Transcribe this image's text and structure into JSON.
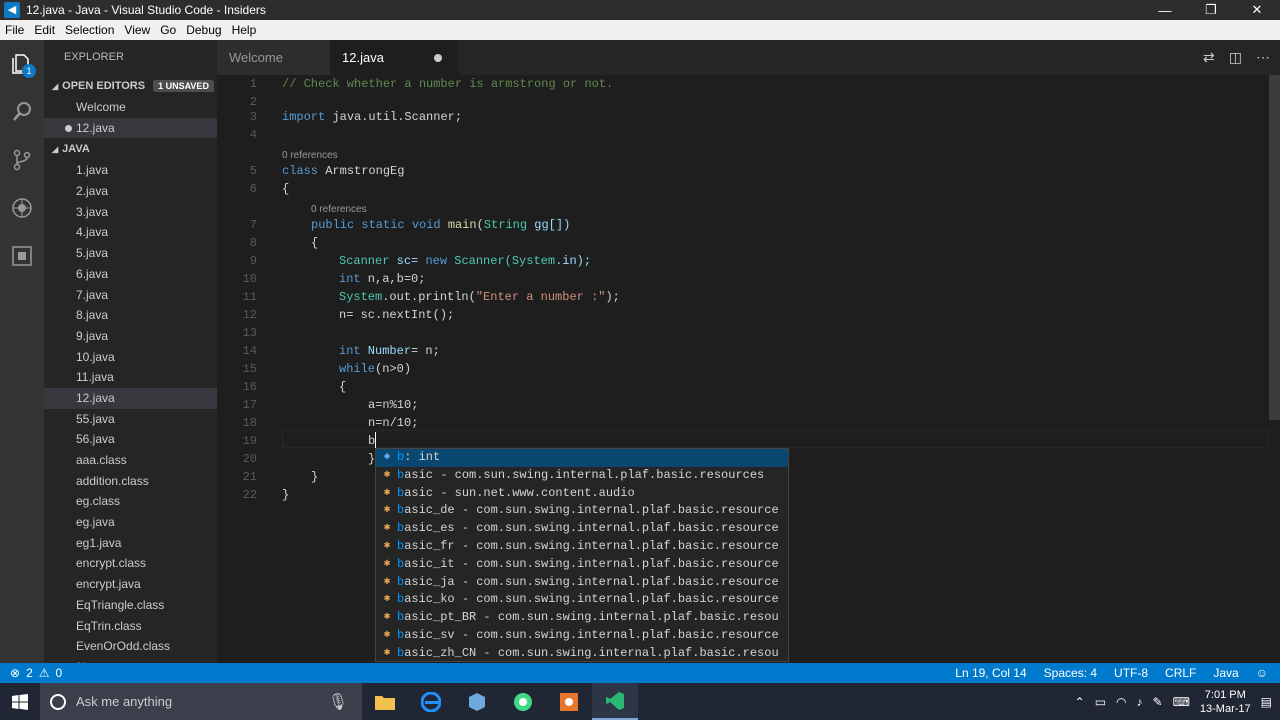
{
  "window": {
    "title": "12.java - Java - Visual Studio Code - Insiders",
    "min": "—",
    "max": "❐",
    "close": "✕"
  },
  "menu": [
    "File",
    "Edit",
    "Selection",
    "View",
    "Go",
    "Debug",
    "Help"
  ],
  "explorer": {
    "title": "EXPLORER",
    "open_editors": "OPEN EDITORS",
    "unsaved_badge": "1 UNSAVED",
    "open_files": [
      "Welcome",
      "12.java"
    ],
    "folder": "JAVA",
    "files": [
      "1.java",
      "2.java",
      "3.java",
      "4.java",
      "5.java",
      "6.java",
      "7.java",
      "8.java",
      "9.java",
      "10.java",
      "11.java",
      "12.java",
      "55.java",
      "56.java",
      "aaa.class",
      "addition.class",
      "eg.class",
      "eg.java",
      "eg1.java",
      "encrypt.class",
      "encrypt.java",
      "EqTriangle.class",
      "EqTrin.class",
      "EvenOrOdd.class",
      "f.java"
    ],
    "active_file": "12.java",
    "badge": "1"
  },
  "tabs": [
    "Welcome",
    "12.java"
  ],
  "code": {
    "l1": "// Check whether a number is armstrong or not.",
    "l3a": "import",
    "l3b": " java.util.Scanner;",
    "refs": "0 references",
    "l5a": "class",
    "l5b": " ArmstrongEg",
    "l6": "{",
    "l7a": "public static void",
    "l7b": " main",
    "l7c": "(",
    "l7d": "String",
    "l7e": " gg[])",
    "l8": "{",
    "l9a": "Scanner",
    "l9b": " sc= ",
    "l9c": "new",
    "l9d": " Scanner",
    "l9e": "(System",
    "l9f": ".in);",
    "l10a": "int",
    "l10b": " n,a,b=0;",
    "l11a": "System",
    "l11b": ".out.println(",
    "l11c": "\"Enter a number :\"",
    "l11d": ");",
    "l12": "n= sc.nextInt();",
    "l14a": "int",
    "l14b": " Number",
    "l14c": "= n;",
    "l15a": "while",
    "l15b": "(n>0)",
    "l16": "{",
    "l17": "a=n%10;",
    "l18": "n=n/10;",
    "l19": "b",
    "l20": "}",
    "l21": "}",
    "l22": "}"
  },
  "line_numbers": [
    "1",
    "2",
    "3",
    "4",
    "5",
    "6",
    "7",
    "8",
    "9",
    "10",
    "11",
    "12",
    "13",
    "14",
    "15",
    "16",
    "17",
    "18",
    "19",
    "20",
    "21",
    "22"
  ],
  "suggest": [
    {
      "hl": "b",
      "rest": " : int"
    },
    {
      "hl": "b",
      "rest": "asic - com.sun.swing.internal.plaf.basic.resources"
    },
    {
      "hl": "b",
      "rest": "asic - sun.net.www.content.audio"
    },
    {
      "hl": "b",
      "rest": "asic_de - com.sun.swing.internal.plaf.basic.resource"
    },
    {
      "hl": "b",
      "rest": "asic_es - com.sun.swing.internal.plaf.basic.resource"
    },
    {
      "hl": "b",
      "rest": "asic_fr - com.sun.swing.internal.plaf.basic.resource"
    },
    {
      "hl": "b",
      "rest": "asic_it - com.sun.swing.internal.plaf.basic.resource"
    },
    {
      "hl": "b",
      "rest": "asic_ja - com.sun.swing.internal.plaf.basic.resource"
    },
    {
      "hl": "b",
      "rest": "asic_ko - com.sun.swing.internal.plaf.basic.resource"
    },
    {
      "hl": "b",
      "rest": "asic_pt_BR - com.sun.swing.internal.plaf.basic.resou"
    },
    {
      "hl": "b",
      "rest": "asic_sv - com.sun.swing.internal.plaf.basic.resource"
    },
    {
      "hl": "b",
      "rest": "asic_zh_CN - com.sun.swing.internal.plaf.basic.resou"
    }
  ],
  "status": {
    "errors": "2",
    "warnings": "0",
    "position": "Ln 19, Col 14",
    "spaces": "Spaces: 4",
    "encoding": "UTF-8",
    "eol": "CRLF",
    "language": "Java"
  },
  "taskbar": {
    "search_placeholder": "Ask me anything",
    "time": "7:01 PM",
    "date": "13-Mar-17"
  },
  "colors": {
    "statusbar": "#007acc",
    "selection": "#094771",
    "editor_bg": "#1e1e1e"
  }
}
